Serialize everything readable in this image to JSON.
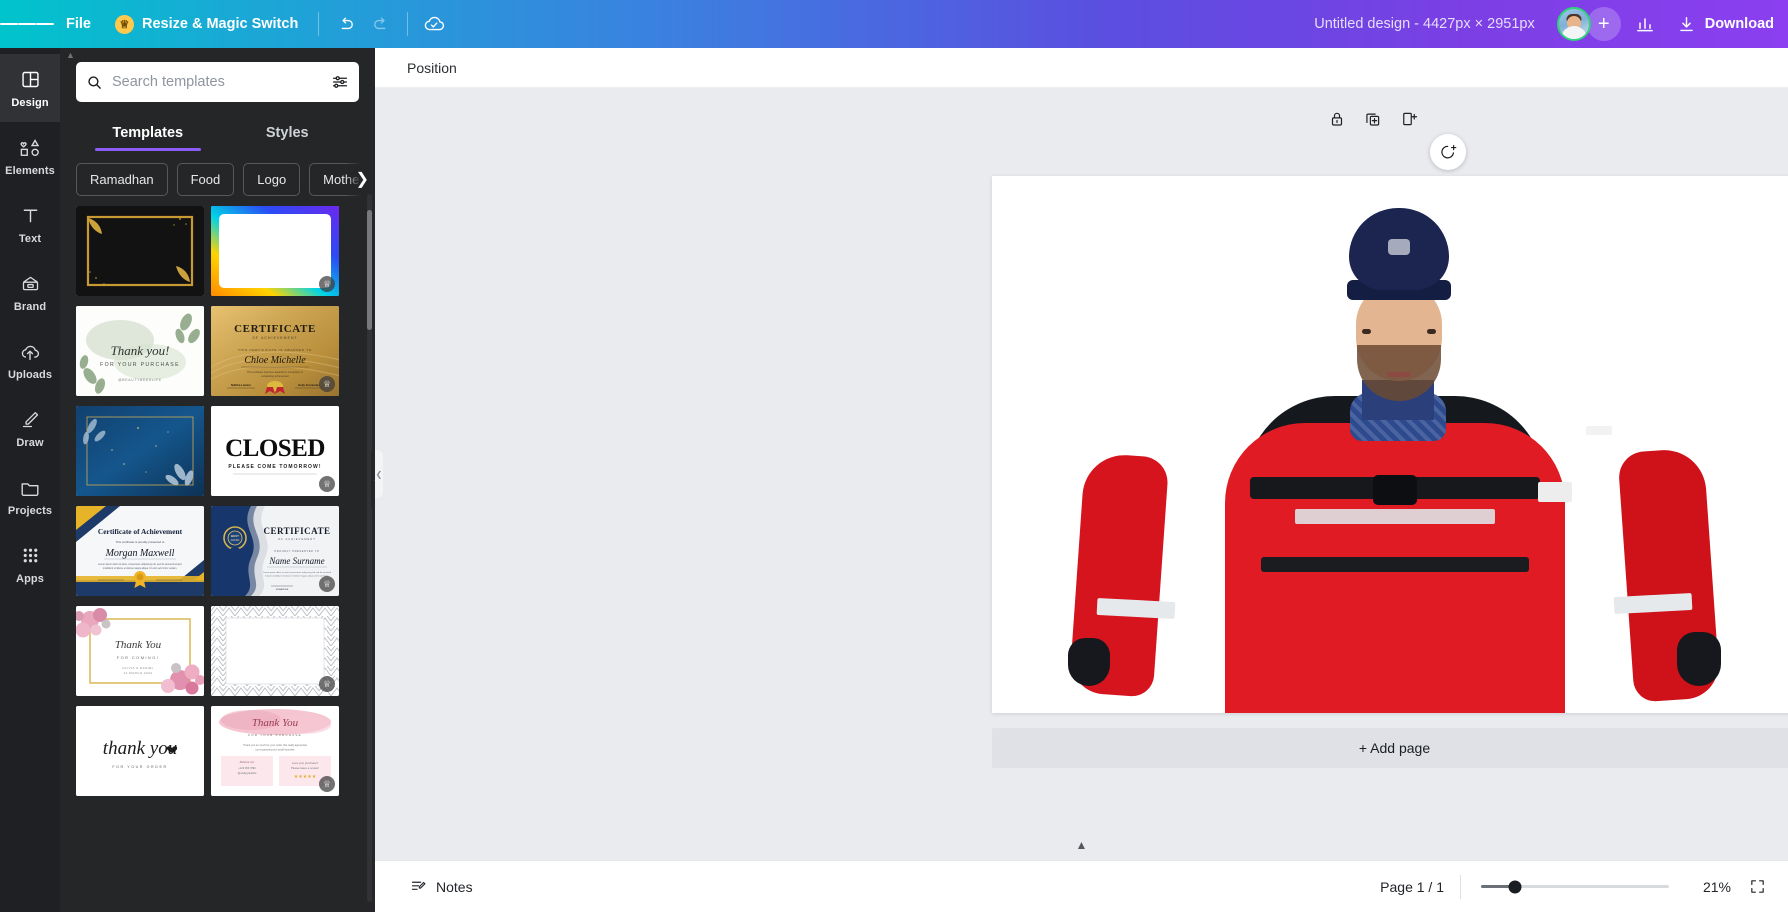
{
  "topbar": {
    "menu_icon": "hamburger-icon",
    "file_label": "File",
    "resize_label": "Resize & Magic Switch",
    "resize_badge_icon": "crown-icon",
    "undo_icon": "undo-icon",
    "redo_icon": "redo-icon",
    "cloud_icon": "cloud-saved-icon",
    "design_title": "Untitled design - 4427px × 2951px",
    "avatar_name": "user-avatar",
    "add_collaborator_label": "+",
    "insights_icon": "bar-chart-icon",
    "download_label": "Download",
    "download_icon": "download-icon"
  },
  "rail": {
    "items": [
      {
        "label": "Design",
        "icon": "layout-icon",
        "active": true
      },
      {
        "label": "Elements",
        "icon": "shapes-icon",
        "active": false
      },
      {
        "label": "Text",
        "icon": "text-t-icon",
        "active": false
      },
      {
        "label": "Brand",
        "icon": "brand-icon",
        "active": false
      },
      {
        "label": "Uploads",
        "icon": "upload-cloud-icon",
        "active": false
      },
      {
        "label": "Draw",
        "icon": "pencil-icon",
        "active": false
      },
      {
        "label": "Projects",
        "icon": "folder-icon",
        "active": false
      },
      {
        "label": "Apps",
        "icon": "grid-dots-icon",
        "active": false
      }
    ]
  },
  "panel": {
    "search": {
      "placeholder": "Search templates",
      "value": "",
      "icon": "search-icon",
      "filter_icon": "sliders-filter-icon"
    },
    "tabs": [
      {
        "label": "Templates",
        "active": true
      },
      {
        "label": "Styles",
        "active": false
      }
    ],
    "chips": [
      "Ramadhan",
      "Food",
      "Logo",
      "Mother"
    ],
    "chips_next_icon": "chevron-right-icon",
    "collapse_icon": "chevron-left-icon",
    "templates": [
      {
        "name": "black-gold-frame-card",
        "premium": false,
        "style": "tpl-black-gold"
      },
      {
        "name": "rainbow-gradient-frame",
        "premium": true,
        "style": "tpl-rainbow"
      },
      {
        "name": "sage-thank-you-purchase",
        "premium": false,
        "style": "tpl-sage",
        "title": "Thank you!",
        "subtitle": "FOR YOUR PURCHASE",
        "footer": "@BEAUTYBEESLIFE"
      },
      {
        "name": "gold-certificate",
        "premium": true,
        "style": "tpl-gold-cert",
        "title": "CERTIFICATE",
        "subtitle": "OF ACHIEVEMENT",
        "recipient": "Chloe Michelle"
      },
      {
        "name": "navy-botanical-frame",
        "premium": false,
        "style": "tpl-navy-bot"
      },
      {
        "name": "closed-sign",
        "premium": true,
        "style": "tpl-closed",
        "title": "CLOSED",
        "subtitle": "PLEASE COME TOMORROW!"
      },
      {
        "name": "certificate-of-achievement",
        "premium": false,
        "style": "tpl-achievement",
        "title": "Certificate of Achievement",
        "recipient": "Morgan Maxwell"
      },
      {
        "name": "navy-seal-certificate",
        "premium": true,
        "style": "tpl-navy-cert",
        "title": "CERTIFICATE",
        "recipient": "Name Surname"
      },
      {
        "name": "pink-floral-thank-you",
        "premium": false,
        "style": "tpl-pink-floral",
        "title": "Thank You",
        "subtitle": "FOR COMING!",
        "footer": "OLIVIA & DANIEL 12 MARCH 2022"
      },
      {
        "name": "chevron-pattern-blank",
        "premium": true,
        "style": "tpl-chevron"
      },
      {
        "name": "script-thank-you-order",
        "premium": false,
        "style": "tpl-script-ty",
        "title": "thank you",
        "subtitle": "FOR YOUR ORDER"
      },
      {
        "name": "pink-watercolor-thank-you",
        "premium": true,
        "style": "tpl-pink-water",
        "title": "Thank You",
        "subtitle": "FOR YOUR PURCHASE"
      }
    ]
  },
  "editor": {
    "position_label": "Position",
    "canvas_tools": [
      {
        "name": "lock-icon"
      },
      {
        "name": "duplicate-page-icon"
      },
      {
        "name": "add-page-icon"
      }
    ],
    "magic_fab_icon": "magic-assistant-icon",
    "add_page_label": "+ Add page",
    "scroll_up_icon": "chevron-up-icon",
    "canvas_image_alt": "person-in-red-jacket-photo"
  },
  "bottombar": {
    "notes_label": "Notes",
    "notes_icon": "notes-icon",
    "page_counter": "Page 1 / 1",
    "zoom_percent": "21%",
    "fit_icon": "expand-icon"
  },
  "colors": {
    "brand_teal": "#00c4cc",
    "brand_purple": "#8b3ff0",
    "tab_underline": "#8b5cf6",
    "rail_bg": "#1f2023",
    "panel_bg": "#252627",
    "canvas_bg": "#eaebef",
    "jacket_red": "#e01b24"
  }
}
